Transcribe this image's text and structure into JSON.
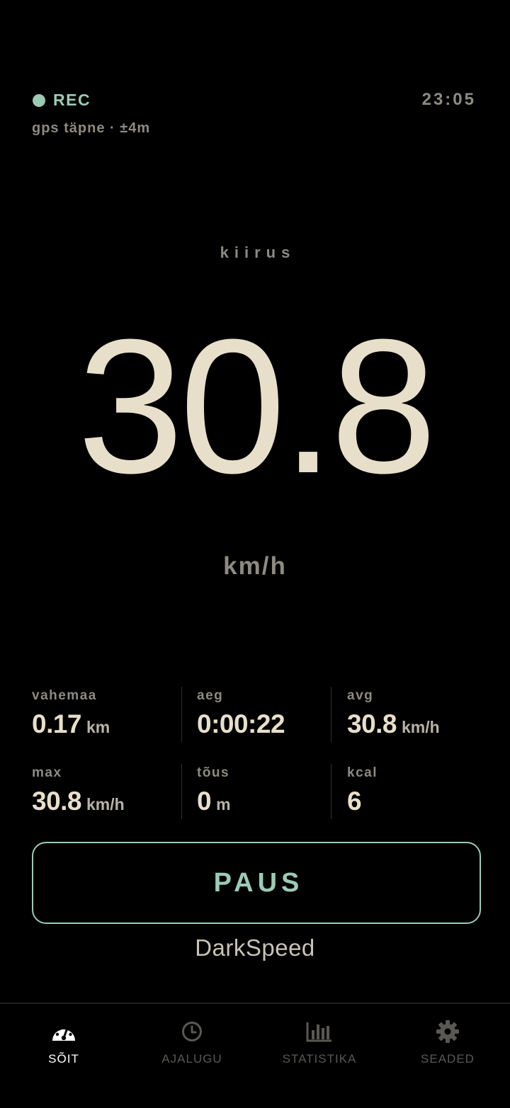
{
  "status": {
    "rec_label": "REC",
    "time": "23:05",
    "gps": "gps täpne · ±4m"
  },
  "speed": {
    "label": "kiirus",
    "value": "30.8",
    "unit": "km/h"
  },
  "stats": [
    {
      "label": "vahemaa",
      "value": "0.17",
      "unit": "km"
    },
    {
      "label": "aeg",
      "value": "0:00:22",
      "unit": ""
    },
    {
      "label": "avg",
      "value": "30.8",
      "unit": "km/h"
    },
    {
      "label": "max",
      "value": "30.8",
      "unit": "km/h"
    },
    {
      "label": "tõus",
      "value": "0",
      "unit": "m"
    },
    {
      "label": "kcal",
      "value": "6",
      "unit": ""
    }
  ],
  "pause_button": {
    "label": "PAUS"
  },
  "brand": "DarkSpeed",
  "nav": [
    {
      "label": "SÕIT",
      "icon": "speedometer-icon",
      "active": true
    },
    {
      "label": "AJALUGU",
      "icon": "clock-icon",
      "active": false
    },
    {
      "label": "STATISTIKA",
      "icon": "bar-chart-icon",
      "active": false
    },
    {
      "label": "SEADED",
      "icon": "gear-icon",
      "active": false
    }
  ],
  "colors": {
    "accent": "#9ccbb5",
    "speed_text": "#e8dfca",
    "muted_text": "#8d8a80",
    "background": "#000000"
  }
}
